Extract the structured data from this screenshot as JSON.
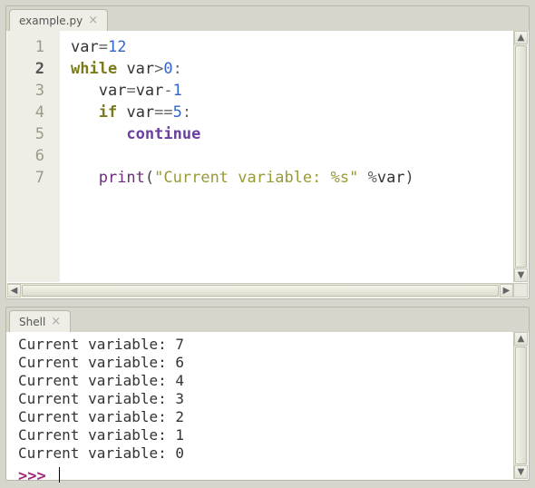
{
  "editor": {
    "tab_label": "example.py",
    "active_line": 2,
    "lines": [
      {
        "n": 1,
        "tokens": [
          [
            "name",
            "var"
          ],
          [
            "op",
            "="
          ],
          [
            "num",
            "12"
          ]
        ]
      },
      {
        "n": 2,
        "tokens": [
          [
            "kw",
            "while"
          ],
          [
            "plain",
            " "
          ],
          [
            "name",
            "var"
          ],
          [
            "op",
            ">"
          ],
          [
            "num",
            "0"
          ],
          [
            "op",
            ":"
          ]
        ]
      },
      {
        "n": 3,
        "tokens": [
          [
            "plain",
            "   "
          ],
          [
            "name",
            "var"
          ],
          [
            "op",
            "="
          ],
          [
            "name",
            "var"
          ],
          [
            "op",
            "-"
          ],
          [
            "num",
            "1"
          ]
        ]
      },
      {
        "n": 4,
        "tokens": [
          [
            "plain",
            "   "
          ],
          [
            "kw",
            "if"
          ],
          [
            "plain",
            " "
          ],
          [
            "name",
            "var"
          ],
          [
            "op",
            "=="
          ],
          [
            "num",
            "5"
          ],
          [
            "op",
            ":"
          ]
        ]
      },
      {
        "n": 5,
        "tokens": [
          [
            "plain",
            "      "
          ],
          [
            "kw2",
            "continue"
          ]
        ]
      },
      {
        "n": 6,
        "tokens": []
      },
      {
        "n": 7,
        "tokens": [
          [
            "plain",
            "   "
          ],
          [
            "func",
            "print"
          ],
          [
            "paren",
            "("
          ],
          [
            "str",
            "\"Current variable: %s\""
          ],
          [
            "plain",
            " "
          ],
          [
            "op",
            "%"
          ],
          [
            "name",
            "var"
          ],
          [
            "paren",
            ")"
          ]
        ]
      }
    ]
  },
  "shell": {
    "tab_label": "Shell",
    "output": [
      "Current variable: 7",
      "Current variable: 6",
      "Current variable: 4",
      "Current variable: 3",
      "Current variable: 2",
      "Current variable: 1",
      "Current variable: 0"
    ],
    "prompt": ">>> "
  }
}
